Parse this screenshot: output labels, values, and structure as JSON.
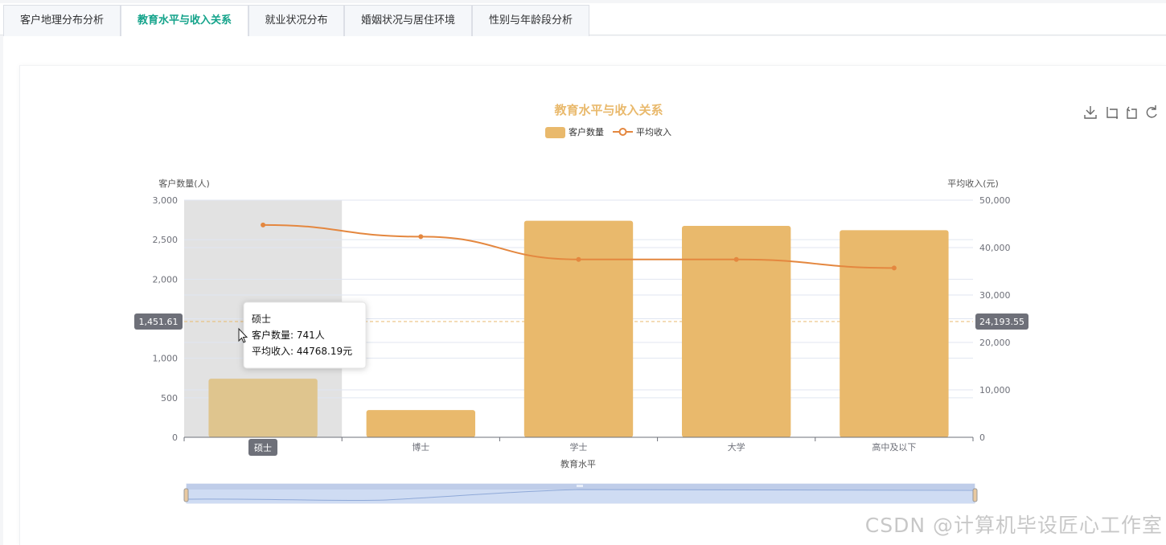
{
  "tabs": [
    {
      "label": "客户地理分布分析",
      "active": false
    },
    {
      "label": "教育水平与收入关系",
      "active": true
    },
    {
      "label": "就业状况分布",
      "active": false
    },
    {
      "label": "婚姻状况与居住环境",
      "active": false
    },
    {
      "label": "性别与年龄段分析",
      "active": false
    }
  ],
  "chart_data": {
    "type": "bar",
    "title": "教育水平与收入关系",
    "legend": [
      "客户数量",
      "平均收入"
    ],
    "legend_placement": "top-center",
    "xlabel": "教育水平",
    "ylabel_left": "客户数量(人)",
    "ylabel_right": "平均收入(元)",
    "categories": [
      "硕士",
      "博士",
      "学士",
      "大学",
      "高中及以下"
    ],
    "ylim_left": [
      0,
      3000
    ],
    "ylim_right": [
      0,
      50000
    ],
    "yticks_left": [
      "0",
      "500",
      "1,000",
      "1,500",
      "2,000",
      "2,500",
      "3,000"
    ],
    "yticks_right": [
      "0",
      "10,000",
      "20,000",
      "30,000",
      "40,000",
      "50,000"
    ],
    "series": [
      {
        "name": "客户数量",
        "type": "bar",
        "axis": "left",
        "values": [
          741,
          345,
          2740,
          2675,
          2620
        ]
      },
      {
        "name": "平均收入",
        "type": "line",
        "axis": "right",
        "smooth": true,
        "values": [
          44768.19,
          42300,
          37500,
          37500,
          35700
        ]
      }
    ],
    "grid": true,
    "colors": {
      "bar": "#e9b96c",
      "bar_highlight": "#dfc58e",
      "line": "#e4873f",
      "title": "#e9b96c"
    },
    "axis_pointer": {
      "category": "硕士",
      "left_value": "1,451.61",
      "right_value": "24,193.55"
    },
    "tooltip": {
      "title": "硕士",
      "line1": "客户数量: 741人",
      "line2": "平均收入: 44768.19元"
    }
  },
  "toolbox": [
    "download-icon",
    "zoom-icon",
    "zoom-reset-icon",
    "refresh-icon"
  ],
  "watermark": "CSDN @计算机毕设匠心工作室"
}
